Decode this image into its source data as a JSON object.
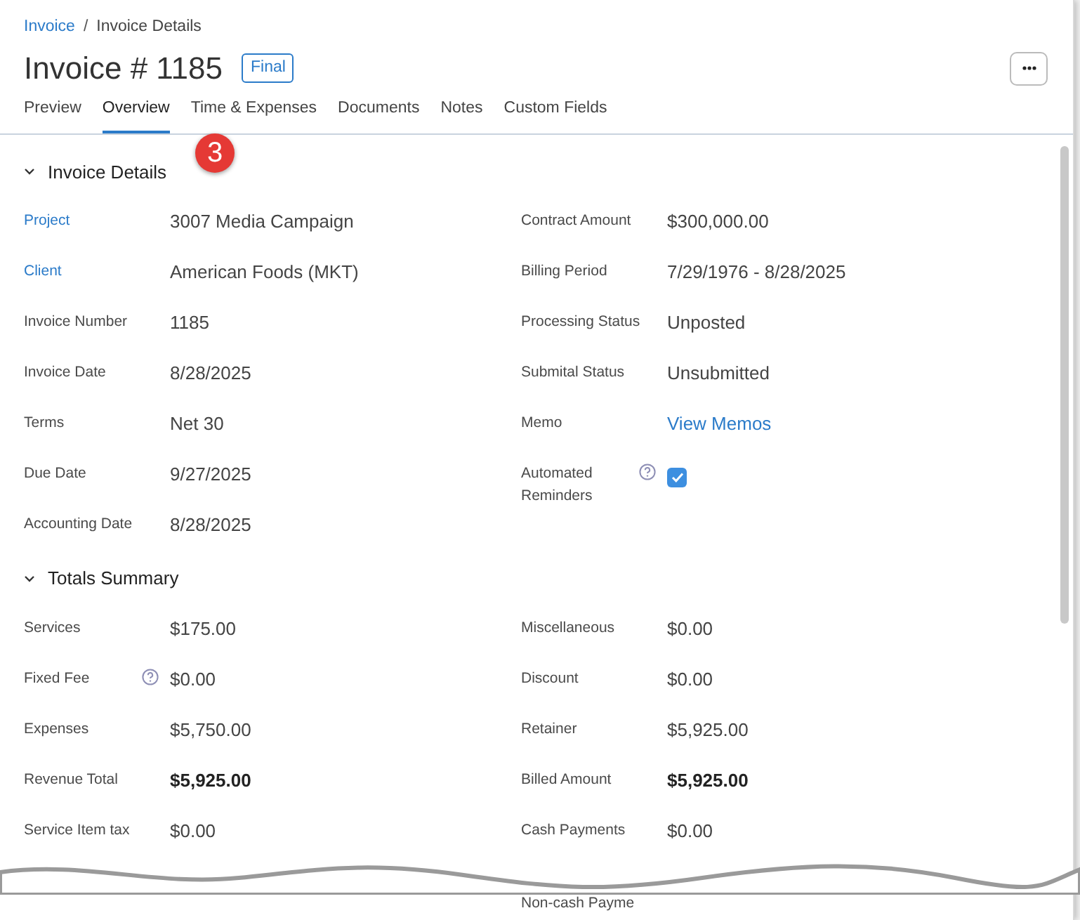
{
  "breadcrumb": [
    {
      "label": "Invoice",
      "kind": "link"
    },
    {
      "label": "/",
      "kind": "separator"
    },
    {
      "label": "Invoice Details",
      "kind": "current"
    }
  ],
  "title": "Invoice # 1185",
  "status_badge": "Final",
  "tabs": [
    {
      "label": "Preview",
      "selected": false
    },
    {
      "label": "Overview",
      "selected": true
    },
    {
      "label": "Time & Expenses",
      "selected": false
    },
    {
      "label": "Documents",
      "selected": false
    },
    {
      "label": "Notes",
      "selected": false
    },
    {
      "label": "Custom Fields",
      "selected": false
    }
  ],
  "callout": "3",
  "sections": [
    {
      "title": "Invoice Details",
      "expanded": true,
      "left": [
        {
          "label": "Project",
          "value": "3007 Media Campaign",
          "kind": "linked"
        },
        {
          "label": "Client",
          "value": "American Foods (MKT)",
          "kind": "linked"
        },
        {
          "label": "Invoice Number",
          "value": "1185",
          "kind": "plain"
        },
        {
          "label": "Invoice Date",
          "value": "8/28/2025",
          "kind": "plain"
        },
        {
          "label": "Terms",
          "value": "Net 30",
          "kind": "plain"
        },
        {
          "label": "Due Date",
          "value": "9/27/2025",
          "kind": "plain"
        },
        {
          "label": "Accounting Date",
          "value": "8/28/2025",
          "kind": "plain"
        }
      ],
      "right": [
        {
          "label": "Contract Amount",
          "value": "$300,000.00",
          "kind": "plain"
        },
        {
          "label": "Billing Period",
          "value": "7/29/1976 - 8/28/2025",
          "kind": "plain"
        },
        {
          "label": "Processing Status",
          "value": "Unposted",
          "kind": "plain"
        },
        {
          "label": "Submital Status",
          "value": "Unsubmitted",
          "kind": "plain"
        },
        {
          "label": "Memo",
          "value": "View Memos",
          "kind": "memo"
        },
        {
          "label": "Automated Reminders",
          "kind": "checkbox",
          "checked": true,
          "help": true
        }
      ]
    },
    {
      "title": "Totals Summary",
      "expanded": true,
      "left": [
        {
          "label": "Services",
          "value": "$175.00",
          "kind": "plain"
        },
        {
          "label": "Fixed Fee",
          "value": "$0.00",
          "kind": "plain",
          "help": true
        },
        {
          "label": "Expenses",
          "value": "$5,750.00",
          "kind": "plain"
        },
        {
          "label": "Revenue Total",
          "value": "$5,925.00",
          "kind": "total"
        },
        {
          "label": "Service Item tax",
          "value": "$0.00",
          "kind": "plain"
        }
      ],
      "right": [
        {
          "label": "Miscellaneous",
          "value": "$0.00",
          "kind": "plain"
        },
        {
          "label": "Discount",
          "value": "$0.00",
          "kind": "plain"
        },
        {
          "label": "Retainer",
          "value": "$5,925.00",
          "kind": "plain"
        },
        {
          "label": "Billed Amount",
          "value": "$5,925.00",
          "kind": "total"
        },
        {
          "label": "Cash Payments",
          "value": "$0.00",
          "kind": "plain"
        }
      ]
    }
  ],
  "cut_off_label": "Non-cash Payme"
}
